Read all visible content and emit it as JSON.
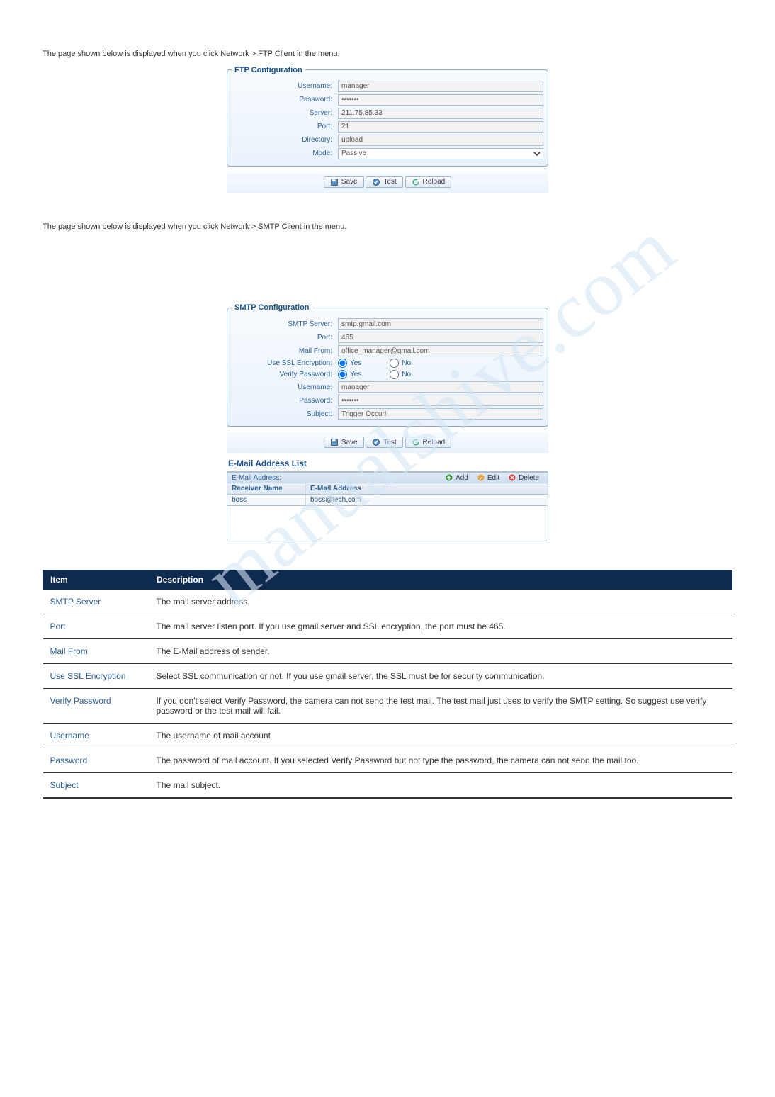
{
  "watermark": "manualshive.com",
  "intro_text_1": "The page shown below is displayed when you click Network > FTP Client in the menu.",
  "ftp": {
    "legend": "FTP Configuration",
    "username_label": "Username:",
    "username_value": "manager",
    "password_label": "Password:",
    "password_value": "•••••••",
    "server_label": "Server:",
    "server_value": "211.75.85.33",
    "port_label": "Port:",
    "port_value": "21",
    "directory_label": "Directory:",
    "directory_value": "upload",
    "mode_label": "Mode:",
    "mode_value": "Passive",
    "save": "Save",
    "test": "Test",
    "reload": "Reload"
  },
  "intro_text_2": "The page shown below is displayed when you click Network > SMTP Client in the menu.",
  "smtp": {
    "legend": "SMTP Configuration",
    "smtp_server_label": "SMTP Server:",
    "smtp_server_value": "smtp.gmail.com",
    "port_label": "Port:",
    "port_value": "465",
    "mail_from_label": "Mail From:",
    "mail_from_value": "office_manager@gmail.com",
    "ssl_label": "Use SSL Encryption:",
    "verify_label": "Verify Password:",
    "yes": "Yes",
    "no": "No",
    "username_label": "Username:",
    "username_value": "manager",
    "password_label": "Password:",
    "password_value": "•••••••",
    "subject_label": "Subject:",
    "subject_value": "Trigger Occur!",
    "save": "Save",
    "test": "Test",
    "reload": "Reload"
  },
  "email_list": {
    "title": "E-Mail Address List",
    "toolbar_label": "E-Mail Address:",
    "add": "Add",
    "edit": "Edit",
    "delete": "Delete",
    "col_receiver": "Receiver Name",
    "col_address": "E-Mail Address",
    "rows": [
      {
        "name": "boss",
        "addr": "boss@tech.com"
      }
    ]
  },
  "desc": {
    "th_item": "Item",
    "th_desc": "Description",
    "rows": [
      {
        "item": "SMTP Server",
        "desc": "The mail server address."
      },
      {
        "item": "Port",
        "desc": "The mail server listen port. If you use gmail server and SSL encryption, the port must be 465."
      },
      {
        "item": "Mail From",
        "desc": "The E-Mail address of sender."
      },
      {
        "item": "Use SSL Encryption",
        "desc": "Select SSL communication or not. If you use gmail server, the SSL must be for security communication."
      },
      {
        "item": "Verify Password",
        "desc": "If you don't select Verify Password, the camera can not send the test mail. The test mail just uses to verify the SMTP setting. So suggest use verify password or the test mail will fail."
      },
      {
        "item": "Username",
        "desc": "The username of mail account"
      },
      {
        "item": "Password",
        "desc": "The password of mail account. If you selected Verify Password but not type the password, the camera can not send the mail too."
      },
      {
        "item": "Subject",
        "desc": "The mail subject."
      }
    ]
  }
}
